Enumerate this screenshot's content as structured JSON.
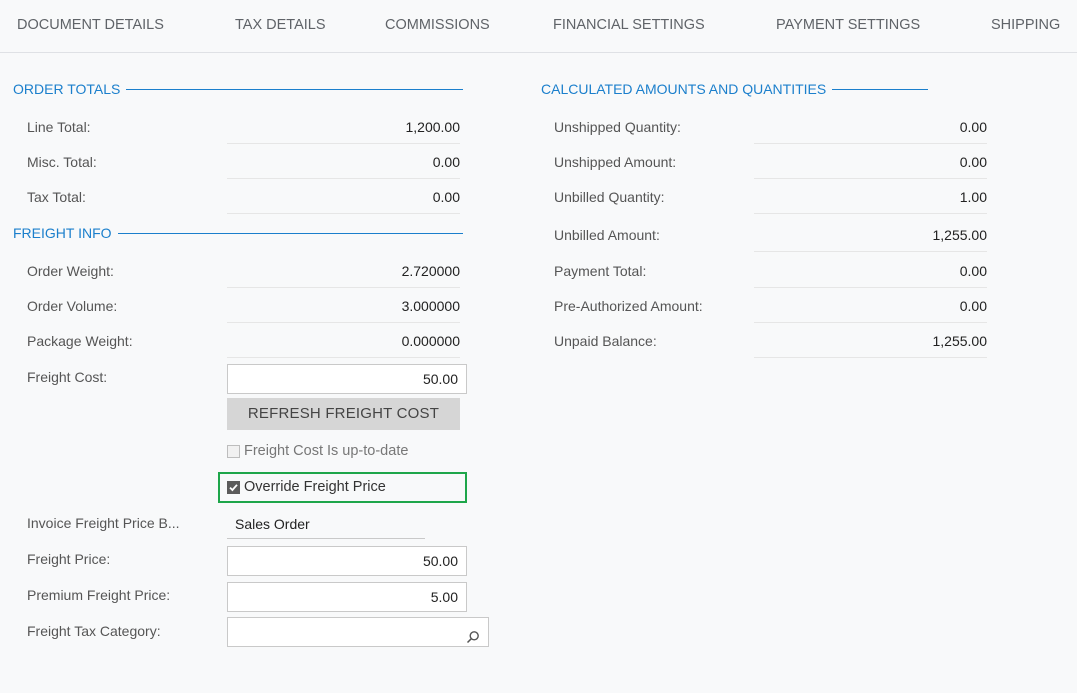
{
  "tabs": [
    "DOCUMENT DETAILS",
    "TAX DETAILS",
    "COMMISSIONS",
    "FINANCIAL SETTINGS",
    "PAYMENT SETTINGS",
    "SHIPPING"
  ],
  "order_totals": {
    "title": "ORDER TOTALS",
    "rows": [
      {
        "label": "Line Total:",
        "value": "1,200.00"
      },
      {
        "label": "Misc. Total:",
        "value": "0.00"
      },
      {
        "label": "Tax Total:",
        "value": "0.00"
      }
    ]
  },
  "freight_info": {
    "title": "FREIGHT INFO",
    "rows": [
      {
        "label": "Order Weight:",
        "value": "2.720000"
      },
      {
        "label": "Order Volume:",
        "value": "3.000000"
      },
      {
        "label": "Package Weight:",
        "value": "0.000000"
      }
    ],
    "freight_cost_label": "Freight Cost:",
    "freight_cost_value": "50.00",
    "refresh_button": "REFRESH FREIGHT COST",
    "uptodate_label": "Freight Cost Is up-to-date",
    "uptodate_checked": false,
    "override_label": "Override Freight Price",
    "override_checked": true,
    "invoice_basis_label": "Invoice Freight Price B...",
    "invoice_basis_value": "Sales Order",
    "freight_price_label": "Freight Price:",
    "freight_price_value": "50.00",
    "premium_label": "Premium Freight Price:",
    "premium_value": "5.00",
    "tax_category_label": "Freight Tax Category:",
    "tax_category_value": ""
  },
  "calculated": {
    "title": "CALCULATED AMOUNTS AND QUANTITIES",
    "rows": [
      {
        "label": "Unshipped Quantity:",
        "value": "0.00"
      },
      {
        "label": "Unshipped Amount:",
        "value": "0.00"
      },
      {
        "label": "Unbilled Quantity:",
        "value": "1.00"
      },
      {
        "label": "Unbilled Amount:",
        "value": "1,255.00"
      },
      {
        "label": "Payment Total:",
        "value": "0.00"
      },
      {
        "label": "Pre-Authorized Amount:",
        "value": "0.00"
      },
      {
        "label": "Unpaid Balance:",
        "value": "1,255.00"
      }
    ]
  },
  "colors": {
    "accent": "#1b7fcc",
    "highlight": "#1ea64a"
  }
}
